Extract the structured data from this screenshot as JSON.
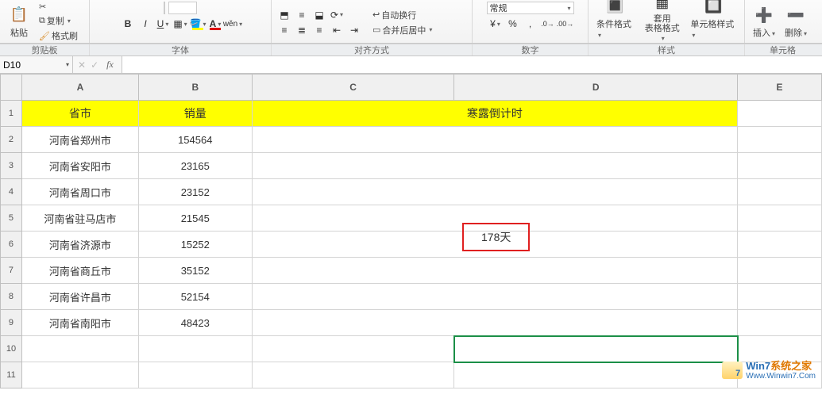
{
  "ribbon": {
    "paste_label": "粘贴",
    "copy_label": "复制",
    "format_painter": "格式刷",
    "merge_label": "合并后居中",
    "auto_wrap": "自动换行",
    "number_format": "常规",
    "cond_fmt": "条件格式",
    "table_fmt_a": "套用",
    "table_fmt_b": "表格格式",
    "cell_style": "单元格样式",
    "insert": "插入",
    "delete": "删除"
  },
  "group_labels": {
    "clipboard": "剪贴板",
    "font": "字体",
    "align": "对齐方式",
    "number": "数字",
    "style": "样式",
    "cells": "单元格"
  },
  "namebox": {
    "ref": "D10"
  },
  "columns": {
    "A": "A",
    "B": "B",
    "C": "C",
    "D": "D",
    "E": "E"
  },
  "headers": {
    "province": "省市",
    "sales": "销量",
    "countdown": "寒露倒计时"
  },
  "rows": [
    {
      "prov": "河南省郑州市",
      "sales": "154564"
    },
    {
      "prov": "河南省安阳市",
      "sales": "23165"
    },
    {
      "prov": "河南省周口市",
      "sales": "23152"
    },
    {
      "prov": "河南省驻马店市",
      "sales": "21545"
    },
    {
      "prov": "河南省济源市",
      "sales": "15252"
    },
    {
      "prov": "河南省商丘市",
      "sales": "35152"
    },
    {
      "prov": "河南省许昌市",
      "sales": "52154"
    },
    {
      "prov": "河南省南阳市",
      "sales": "48423"
    }
  ],
  "countdown_box": "178天",
  "watermark": {
    "title": "Win7系统之家",
    "url": "Www.Winwin7.Com"
  },
  "chart_data": {
    "type": "table",
    "title": "寒露倒计时",
    "columns": [
      "省市",
      "销量"
    ],
    "rows": [
      [
        "河南省郑州市",
        154564
      ],
      [
        "河南省安阳市",
        23165
      ],
      [
        "河南省周口市",
        23152
      ],
      [
        "河南省驻马店市",
        21545
      ],
      [
        "河南省济源市",
        15252
      ],
      [
        "河南省商丘市",
        35152
      ],
      [
        "河南省许昌市",
        52154
      ],
      [
        "河南省南阳市",
        48423
      ]
    ],
    "annotation": "178天"
  }
}
